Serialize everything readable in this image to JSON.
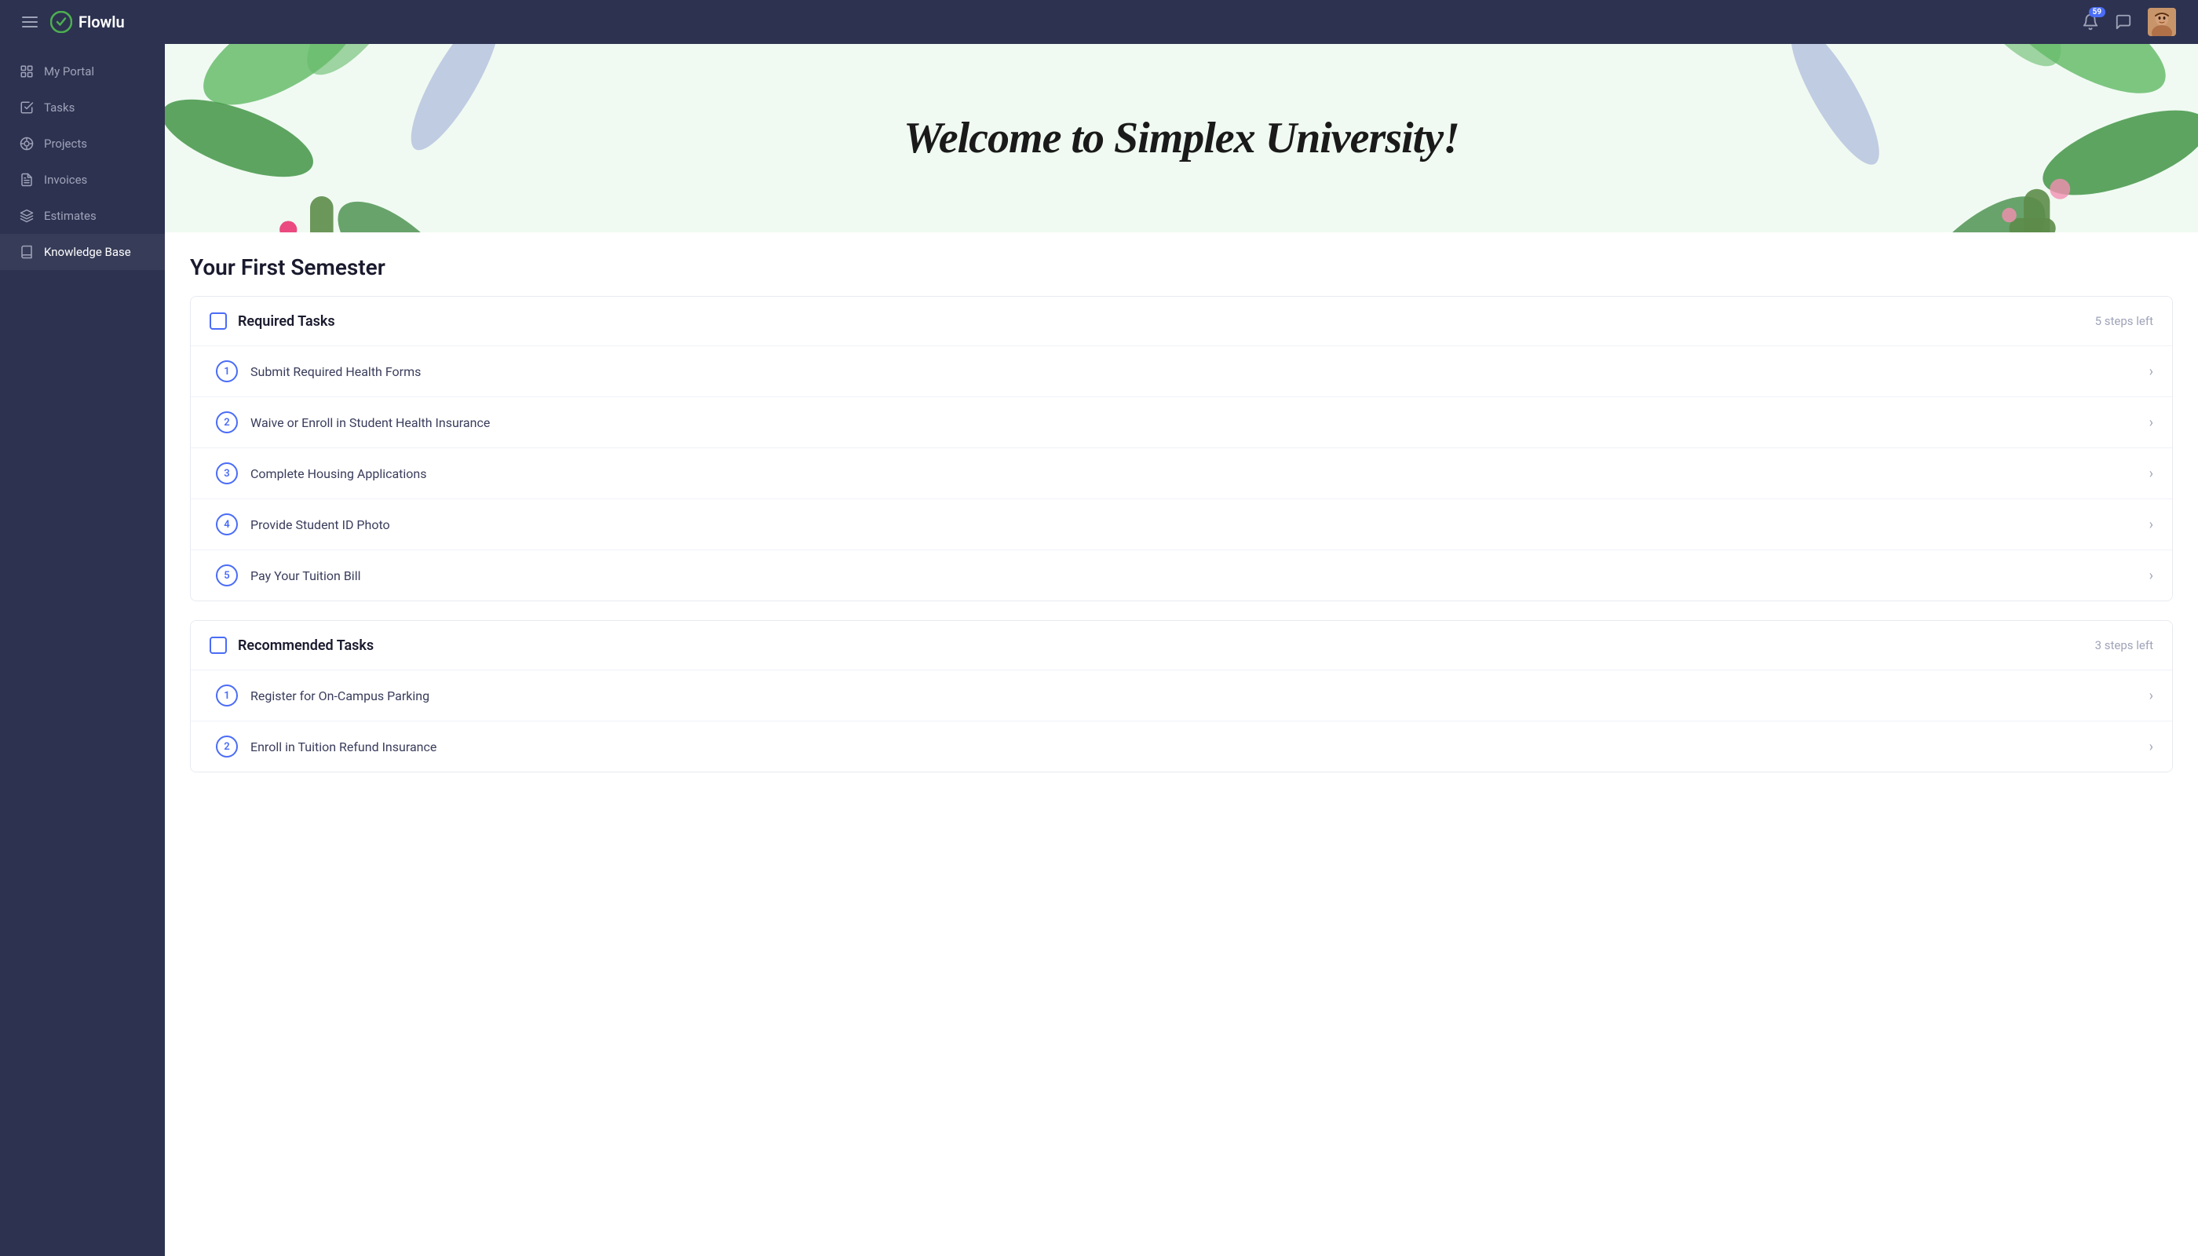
{
  "header": {
    "menu_icon": "hamburger",
    "logo_text": "Flowlu",
    "notif_count": "59",
    "avatar_alt": "User Avatar"
  },
  "sidebar": {
    "items": [
      {
        "id": "my-portal",
        "label": "My Portal",
        "icon": "portal"
      },
      {
        "id": "tasks",
        "label": "Tasks",
        "icon": "tasks"
      },
      {
        "id": "projects",
        "label": "Projects",
        "icon": "projects"
      },
      {
        "id": "invoices",
        "label": "Invoices",
        "icon": "invoices"
      },
      {
        "id": "estimates",
        "label": "Estimates",
        "icon": "estimates"
      },
      {
        "id": "knowledge-base",
        "label": "Knowledge Base",
        "icon": "book"
      }
    ]
  },
  "banner": {
    "title": "Welcome to Simplex University!"
  },
  "main": {
    "section_title": "Your First Semester",
    "required_tasks": {
      "title": "Required Tasks",
      "steps_left": "5 steps left",
      "items": [
        {
          "num": "1",
          "label": "Submit Required Health Forms"
        },
        {
          "num": "2",
          "label": "Waive or Enroll in Student Health Insurance"
        },
        {
          "num": "3",
          "label": "Complete Housing Applications"
        },
        {
          "num": "4",
          "label": "Provide Student ID Photo"
        },
        {
          "num": "5",
          "label": "Pay Your Tuition Bill"
        }
      ]
    },
    "recommended_tasks": {
      "title": "Recommended Tasks",
      "steps_left": "3 steps left",
      "items": [
        {
          "num": "1",
          "label": "Register for On-Campus Parking"
        },
        {
          "num": "2",
          "label": "Enroll in Tuition Refund Insurance"
        }
      ]
    }
  }
}
